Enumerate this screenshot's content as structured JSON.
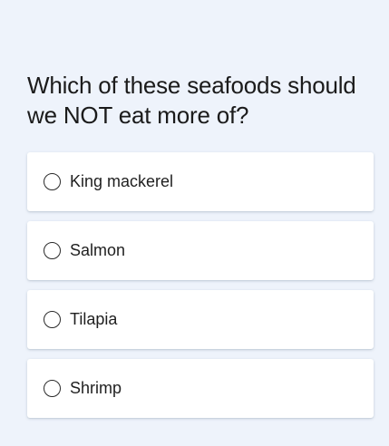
{
  "question": "Which of these seafoods should we NOT eat more of?",
  "options": [
    {
      "label": "King mackerel",
      "selected": false
    },
    {
      "label": "Salmon",
      "selected": false
    },
    {
      "label": "Tilapia",
      "selected": false
    },
    {
      "label": "Shrimp",
      "selected": false
    }
  ],
  "colors": {
    "background": "#eef3fb",
    "card": "#ffffff",
    "text": "#1b1b1b"
  }
}
